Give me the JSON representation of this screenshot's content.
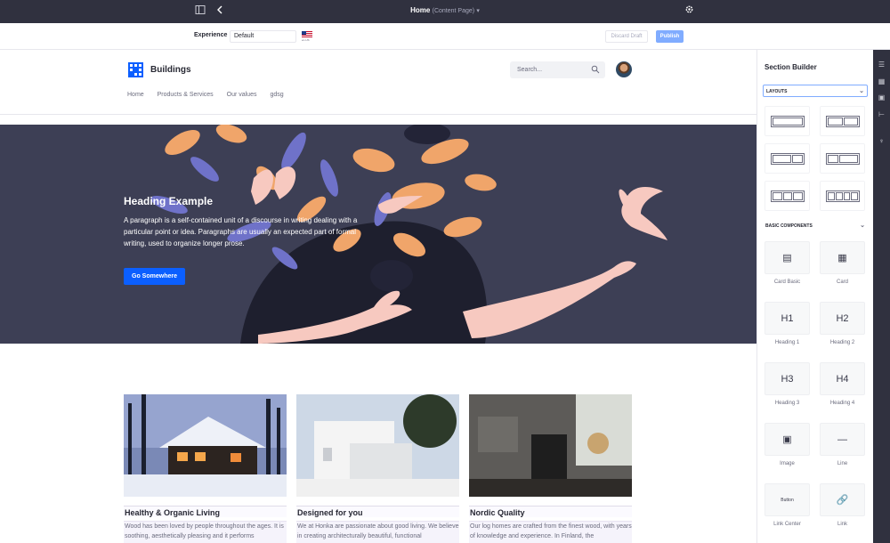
{
  "topbar": {
    "page_title": "Home",
    "page_subtitle": "(Content Page)"
  },
  "toolbar": {
    "experience_label": "Experience",
    "experience_value": "Default",
    "flag_text": "en-US",
    "discard_label": "Discard Draft",
    "publish_label": "Publish"
  },
  "site": {
    "name": "Buildings",
    "nav": [
      "Home",
      "Products & Services",
      "Our values",
      "gdsg"
    ],
    "search_placeholder": "Search..."
  },
  "hero": {
    "heading": "Heading Example",
    "paragraph": "A paragraph is a self-contained unit of a discourse in writing dealing with a particular point or idea. Paragraphs are usually an expected part of formal writing, used to organize longer prose.",
    "button": "Go Somewhere"
  },
  "cards": [
    {
      "title": "Healthy & Organic Living",
      "text": "Wood has been loved by people throughout the ages. It is soothing, aesthetically pleasing and it performs"
    },
    {
      "title": "Designed for you",
      "text": "We at Honka are passionate about good living. We believe in creating architecturally beautiful, functional"
    },
    {
      "title": "Nordic Quality",
      "text": "Our log homes are crafted from the finest wood, with years of knowledge and experience. In Finland, the"
    }
  ],
  "section_builder": {
    "title": "Section Builder",
    "layouts_label": "LAYOUTS",
    "basic_components_label": "BASIC COMPONENTS",
    "components": [
      {
        "label": "Card Basic",
        "glyph": "▤"
      },
      {
        "label": "Card",
        "glyph": "▦"
      },
      {
        "label": "Heading 1",
        "glyph": "H1"
      },
      {
        "label": "Heading 2",
        "glyph": "H2"
      },
      {
        "label": "Heading 3",
        "glyph": "H3"
      },
      {
        "label": "Heading 4",
        "glyph": "H4"
      },
      {
        "label": "Image",
        "glyph": "▣"
      },
      {
        "label": "Line",
        "glyph": "—"
      },
      {
        "label": "Link Center",
        "glyph": "Button"
      },
      {
        "label": "Link",
        "glyph": "🔗"
      }
    ]
  },
  "colors": {
    "topbar": "#30313f",
    "primary": "#0b5fff",
    "publish": "#80acff",
    "hero_bg": "#3d3f55"
  }
}
